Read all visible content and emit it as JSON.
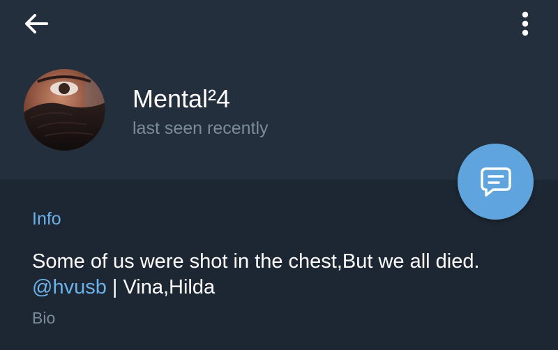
{
  "header": {
    "back_icon": "arrow-left-icon",
    "menu_icon": "more-vertical-icon",
    "background": "#242f3d"
  },
  "profile": {
    "name": "Mental²4",
    "status": "last seen recently"
  },
  "fab": {
    "icon": "message-icon",
    "color": "#5fa4dc"
  },
  "info": {
    "title": "Info",
    "bio_text": "Some of us were shot in the chest,But we all died.",
    "bio_mention": "@hvusb",
    "bio_rest": " | Vina,Hilda",
    "bio_label": "Bio"
  },
  "colors": {
    "accent": "#6cb2ea",
    "page_background": "#1d2733",
    "secondary_text": "#7c8b9a"
  }
}
